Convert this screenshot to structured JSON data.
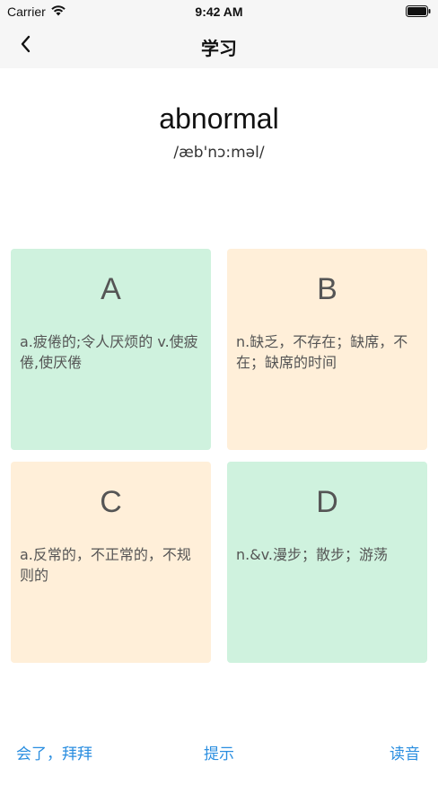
{
  "status_bar": {
    "carrier": "Carrier",
    "time": "9:42 AM",
    "wifi_icon": "wifi-icon",
    "battery_icon": "battery-icon"
  },
  "nav": {
    "back_icon": "chevron-left-icon",
    "title": "学习"
  },
  "word": {
    "text": "abnormal",
    "phonetic": "/æb'nɔ:məl/"
  },
  "options": [
    {
      "letter": "A",
      "meaning": "a.疲倦的;令人厌烦的 v.使疲倦,使厌倦",
      "color": "#cff2de"
    },
    {
      "letter": "B",
      "meaning": "n.缺乏，不存在；缺席，不在；缺席的时间",
      "color": "#ffefd9"
    },
    {
      "letter": "C",
      "meaning": "a.反常的，不正常的，不规则的",
      "color": "#ffefd9"
    },
    {
      "letter": "D",
      "meaning": "n.&v.漫步；散步；游荡",
      "color": "#cff2de"
    }
  ],
  "actions": {
    "known": "会了，拜拜",
    "hint": "提示",
    "read": "读音"
  },
  "colors": {
    "accent": "#2a8ee0"
  }
}
